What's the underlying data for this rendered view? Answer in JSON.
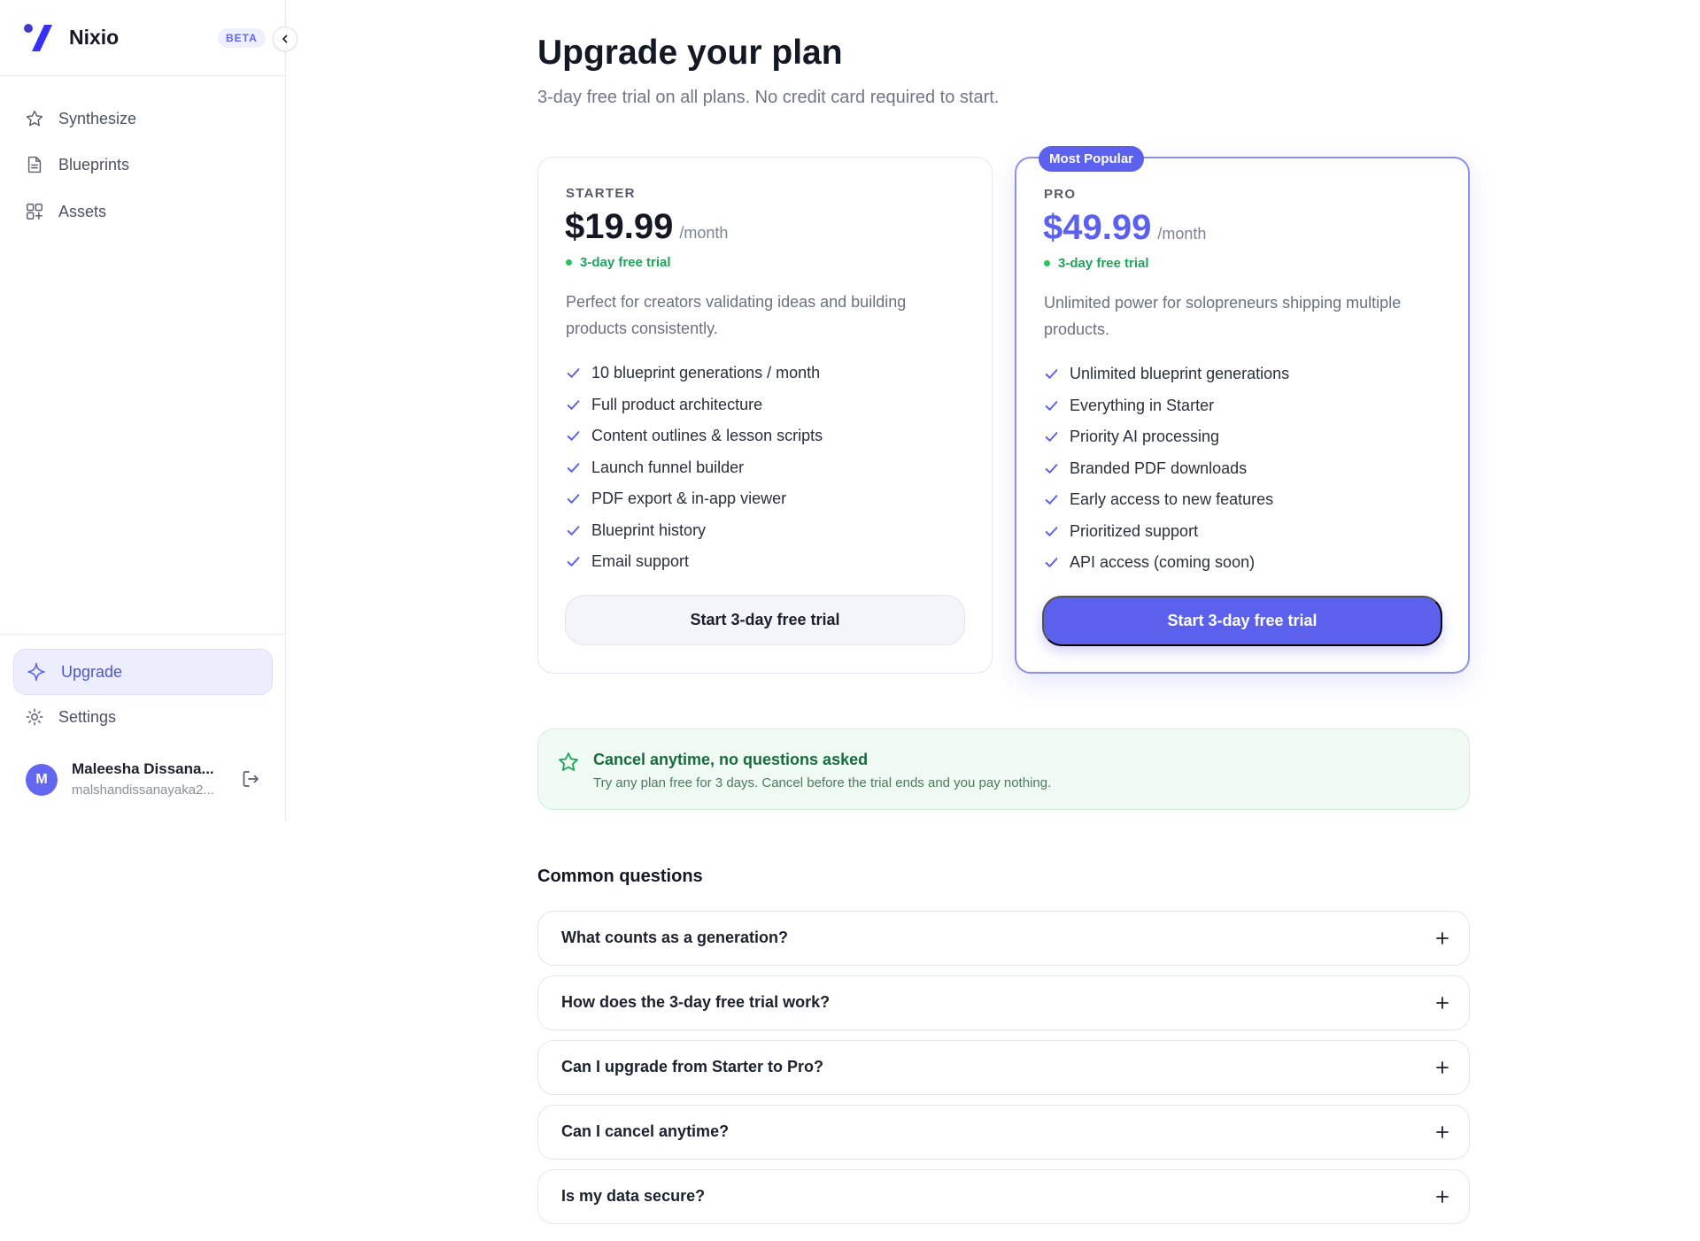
{
  "brand": {
    "name": "Nixio",
    "badge": "BETA",
    "color": "#4f46e5"
  },
  "sidebar": {
    "nav": [
      {
        "label": "Synthesize",
        "icon": "star-icon"
      },
      {
        "label": "Blueprints",
        "icon": "document-icon"
      },
      {
        "label": "Assets",
        "icon": "grid-plus-icon"
      }
    ],
    "upgrade_label": "Upgrade",
    "settings_label": "Settings",
    "user": {
      "initial": "M",
      "name": "Maleesha Dissana...",
      "email": "malshandissanayaka2..."
    }
  },
  "page": {
    "title": "Upgrade your plan",
    "subtitle": "3-day free trial on all plans. No credit card required to start."
  },
  "plans": [
    {
      "name": "STARTER",
      "price": "$19.99",
      "period": "/month",
      "trial": "3-day free trial",
      "description": "Perfect for creators validating ideas and building products consistently.",
      "features": [
        "10 blueprint generations / month",
        "Full product architecture",
        "Content outlines & lesson scripts",
        "Launch funnel builder",
        "PDF export & in-app viewer",
        "Blueprint history",
        "Email support"
      ],
      "cta": "Start 3-day free trial"
    },
    {
      "name": "PRO",
      "badge": "Most Popular",
      "price": "$49.99",
      "period": "/month",
      "trial": "3-day free trial",
      "description": "Unlimited power for solopreneurs shipping multiple products.",
      "features": [
        "Unlimited blueprint generations",
        "Everything in Starter",
        "Priority AI processing",
        "Branded PDF downloads",
        "Early access to new features",
        "Prioritized support",
        "API access (coming soon)"
      ],
      "cta": "Start 3-day free trial"
    }
  ],
  "cancel_notice": {
    "title": "Cancel anytime, no questions asked",
    "text": "Try any plan free for 3 days. Cancel before the trial ends and you pay nothing."
  },
  "faq": {
    "heading": "Common questions",
    "items": [
      "What counts as a generation?",
      "How does the 3-day free trial work?",
      "Can I upgrade from Starter to Pro?",
      "Can I cancel anytime?",
      "Is my data secure?"
    ]
  },
  "colors": {
    "accent": "#5b61ec",
    "success": "#21a35b",
    "success_bg": "#eefaf2"
  }
}
